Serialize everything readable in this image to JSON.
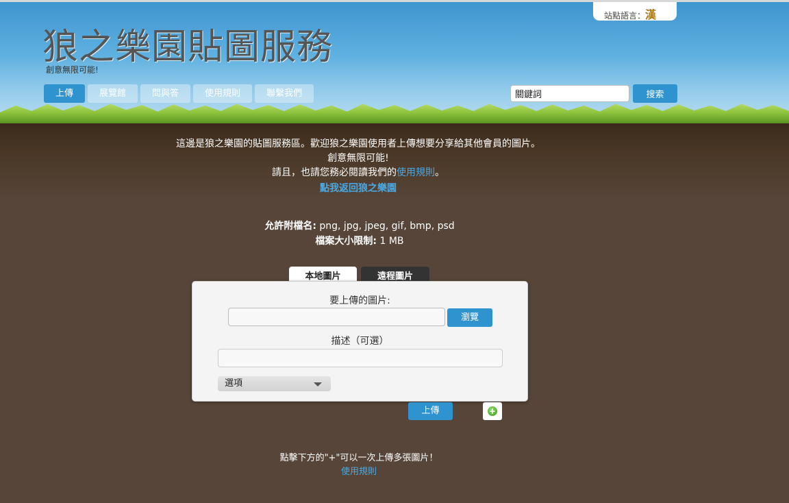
{
  "language": {
    "label": "站點語言：",
    "current": "漢"
  },
  "header": {
    "title": "狼之樂園貼圖服務",
    "tagline": "創意無限可能!"
  },
  "nav": {
    "items": [
      {
        "label": "上傳",
        "active": true
      },
      {
        "label": "展覽館"
      },
      {
        "label": "問與答"
      },
      {
        "label": "使用規則"
      },
      {
        "label": "聯繫我們"
      }
    ]
  },
  "search": {
    "value": "關鍵詞",
    "button": "搜索"
  },
  "intro": {
    "line1": "這邊是狼之樂園的貼圖服務區。歡迎狼之樂園使用者上傳想要分享給其他會員的圖片。",
    "line2": "創意無限可能!",
    "line3_before": "請且，也請您務必閱讀我們的",
    "line3_link": "使用規則",
    "line3_after": "。",
    "home_link": "點我返回狼之樂園"
  },
  "limits": {
    "ext_label": "允許附檔名:",
    "ext_value": " png, jpg, jpeg, gif, bmp, psd",
    "size_label": "檔案大小限制:",
    "size_value": " 1 MB"
  },
  "tabs": {
    "local": "本地圖片",
    "remote": "遠程圖片"
  },
  "form": {
    "file_label": "要上傳的圖片:",
    "browse_button": "瀏覽",
    "desc_label": "描述（可選）",
    "options_select": "選項"
  },
  "actions": {
    "upload_button": "上傳",
    "add_symbol": "+"
  },
  "footer": {
    "hint": "點擊下方的\"+\"可以一次上傳多張圖片！",
    "rules_link": "使用規則"
  },
  "colors": {
    "accent": "#2f93cf",
    "link": "#4aa9e4",
    "soil": "#564538"
  }
}
